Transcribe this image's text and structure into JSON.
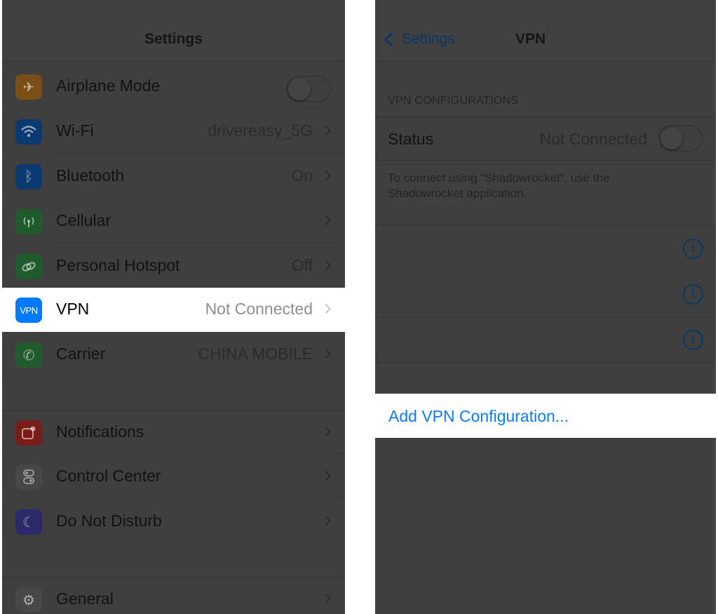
{
  "left": {
    "title": "Settings",
    "rows": [
      {
        "label": "Airplane Mode",
        "value": "",
        "icon": "airplane-icon",
        "color": "#ff9500"
      },
      {
        "label": "Wi-Fi",
        "value": "drivereasy_5G",
        "icon": "wifi-icon",
        "color": "#007aff"
      },
      {
        "label": "Bluetooth",
        "value": "On",
        "icon": "bluetooth-icon",
        "color": "#007aff"
      },
      {
        "label": "Cellular",
        "value": "",
        "icon": "cellular-icon",
        "color": "#4cd964"
      },
      {
        "label": "Personal Hotspot",
        "value": "Off",
        "icon": "hotspot-icon",
        "color": "#4cd964"
      },
      {
        "label": "VPN",
        "value": "Not Connected",
        "icon": "vpn-icon",
        "icon_text": "VPN",
        "color": "#007aff"
      },
      {
        "label": "Carrier",
        "value": "CHINA MOBILE",
        "icon": "phone-icon",
        "color": "#4cd964"
      },
      {
        "label": "Notifications",
        "value": "",
        "icon": "notifications-icon",
        "color": "#ff3b30"
      },
      {
        "label": "Control Center",
        "value": "",
        "icon": "control-center-icon",
        "color": "#8e8e93"
      },
      {
        "label": "Do Not Disturb",
        "value": "",
        "icon": "moon-icon",
        "color": "#5856d6"
      },
      {
        "label": "General",
        "value": "",
        "icon": "gear-icon",
        "color": "#8e8e93"
      }
    ]
  },
  "right": {
    "back_label": "Settings",
    "title": "VPN",
    "section_header": "VPN CONFIGURATIONS",
    "status_label": "Status",
    "status_value": "Not Connected",
    "footer": "To connect using “Shadowrocket”, use the Shadowrocket application.",
    "add_label": "Add VPN Configuration..."
  },
  "colors": {
    "accent": "#007aff",
    "dim_overlay": "#404040"
  }
}
